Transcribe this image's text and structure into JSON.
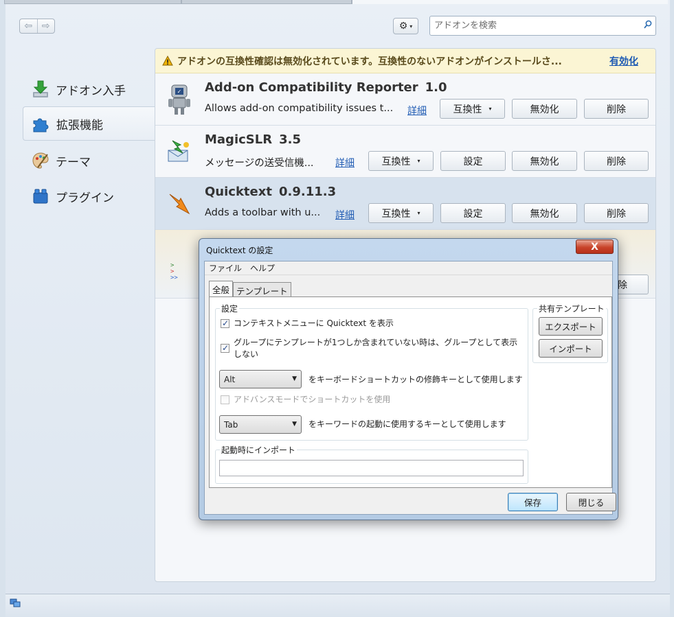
{
  "toolbar": {
    "back_icon": "back-arrow-icon",
    "forward_icon": "forward-arrow-icon",
    "tools_icon": "gear-icon",
    "search_placeholder": "アドオンを検索"
  },
  "sidebar": {
    "items": [
      {
        "label": "アドオン入手",
        "icon": "download-icon",
        "selected": false
      },
      {
        "label": "拡張機能",
        "icon": "puzzle-piece-icon",
        "selected": true
      },
      {
        "label": "テーマ",
        "icon": "palette-icon",
        "selected": false
      },
      {
        "label": "プラグイン",
        "icon": "lego-brick-icon",
        "selected": false
      }
    ]
  },
  "warning": {
    "text": "アドオンの互換性確認は無効化されています。互換性のないアドオンがインストールさ...",
    "link": "有効化"
  },
  "addons": [
    {
      "name": "Add-on Compatibility Reporter",
      "version": "1.0",
      "description": "Allows add-on compatibility issues t...",
      "details": "詳細",
      "compat": "互換性",
      "disable": "無効化",
      "remove": "削除"
    },
    {
      "name": "MagicSLR",
      "version": "3.5",
      "description": "メッセージの送受信機...",
      "details": "詳細",
      "compat": "互換性",
      "settings": "設定",
      "disable": "無効化",
      "remove": "削除"
    },
    {
      "name": "Quicktext",
      "version": "0.9.11.3",
      "description": "Adds a toolbar with u...",
      "details": "詳細",
      "compat": "互換性",
      "settings": "設定",
      "disable": "無効化",
      "remove": "削除"
    },
    {
      "remove_partial": "除"
    }
  ],
  "dialog": {
    "title": "Quicktext の設定",
    "close": "X",
    "menu": [
      "ファイル",
      "ヘルプ"
    ],
    "tabs": [
      "全般",
      "テンプレート"
    ],
    "settings_group": "設定",
    "opt_context_menu": "コンテキストメニューに Quicktext を表示",
    "opt_context_menu_checked": true,
    "opt_group_line1": "グループにテンプレートが1つしか含まれていない時は、グループとして表示",
    "opt_group_line2": "しない",
    "opt_group_checked": true,
    "modifier_value": "Alt",
    "modifier_label": "をキーボードショートカットの修飾キーとして使用します",
    "opt_advanced": "アドバンスモードでショートカットを使用",
    "opt_advanced_checked": false,
    "keyword_value": "Tab",
    "keyword_label": "をキーワードの起動に使用するキーとして使用します",
    "shared_group": "共有テンプレート",
    "export": "エクスポート",
    "import": "インポート",
    "startup_group": "起動時にインポート",
    "startup_value": "",
    "save": "保存",
    "close_btn": "閉じる"
  }
}
